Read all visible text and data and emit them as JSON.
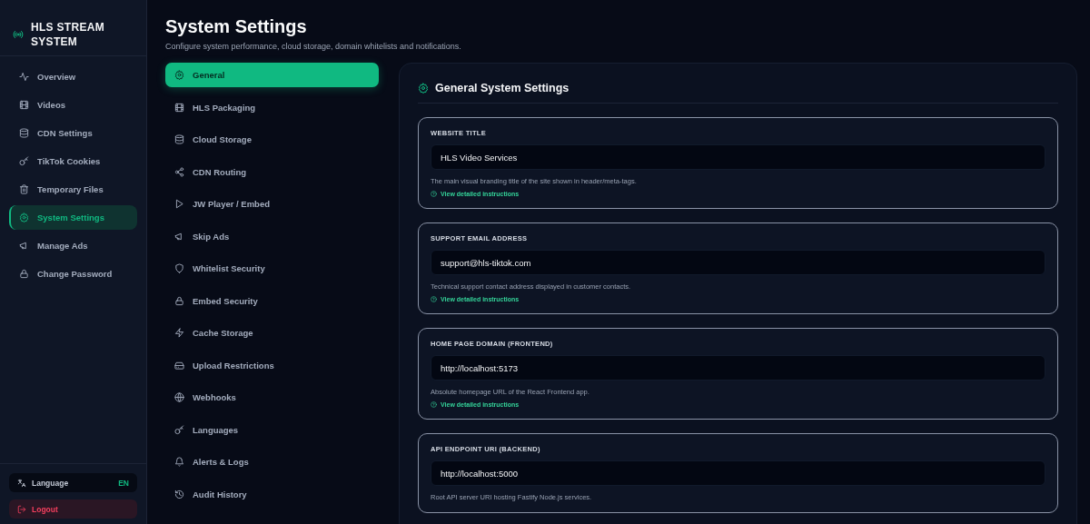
{
  "brand": {
    "title": "HLS STREAM SYSTEM"
  },
  "sidebar": {
    "items": [
      {
        "label": "Overview",
        "selected": false
      },
      {
        "label": "Videos",
        "selected": false
      },
      {
        "label": "CDN Settings",
        "selected": false
      },
      {
        "label": "TikTok Cookies",
        "selected": false
      },
      {
        "label": "Temporary Files",
        "selected": false
      },
      {
        "label": "System Settings",
        "selected": true
      },
      {
        "label": "Manage Ads",
        "selected": false
      },
      {
        "label": "Change Password",
        "selected": false
      }
    ],
    "language": {
      "label": "Language",
      "value": "EN"
    },
    "logout": "Logout"
  },
  "header": {
    "title": "System Settings",
    "subtitle": "Configure system performance, cloud storage, domain whitelists and notifications."
  },
  "tabs": [
    {
      "label": "General",
      "selected": true
    },
    {
      "label": "HLS Packaging",
      "selected": false
    },
    {
      "label": "Cloud Storage",
      "selected": false
    },
    {
      "label": "CDN Routing",
      "selected": false
    },
    {
      "label": "JW Player / Embed",
      "selected": false
    },
    {
      "label": "Skip Ads",
      "selected": false
    },
    {
      "label": "Whitelist Security",
      "selected": false
    },
    {
      "label": "Embed Security",
      "selected": false
    },
    {
      "label": "Cache Storage",
      "selected": false
    },
    {
      "label": "Upload Restrictions",
      "selected": false
    },
    {
      "label": "Webhooks",
      "selected": false
    },
    {
      "label": "Languages",
      "selected": false
    },
    {
      "label": "Alerts & Logs",
      "selected": false
    },
    {
      "label": "Audit History",
      "selected": false
    }
  ],
  "panel": {
    "title": "General System Settings",
    "fields": [
      {
        "label": "WEBSITE TITLE",
        "value": "HLS Video Services",
        "help": "The main visual branding title of the site shown in header/meta-tags.",
        "link": "View detailed instructions"
      },
      {
        "label": "SUPPORT EMAIL ADDRESS",
        "value": "support@hls-tiktok.com",
        "help": "Technical support contact address displayed in customer contacts.",
        "link": "View detailed instructions"
      },
      {
        "label": "HOME PAGE DOMAIN (FRONTEND)",
        "value": "http://localhost:5173",
        "help": "Absolute homepage URL of the React Frontend app.",
        "link": "View detailed instructions"
      },
      {
        "label": "API ENDPOINT URI (BACKEND)",
        "value": "http://localhost:5000",
        "help": "Root API server URI hosting Fastify Node.js services."
      }
    ]
  }
}
